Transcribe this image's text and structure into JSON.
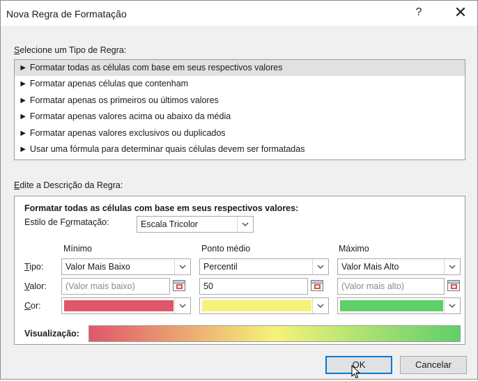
{
  "window": {
    "title": "Nova Regra de Formatação",
    "help_glyph": "?",
    "close_glyph": "✕"
  },
  "rule_type": {
    "heading_access": "S",
    "heading_rest": "elecione um Tipo de Regra:",
    "items": [
      "► Formatar todas as células com base em seus respectivos valores",
      "► Formatar apenas células que contenham",
      "► Formatar apenas os primeiros ou últimos valores",
      "► Formatar apenas valores acima ou abaixo da média",
      "► Formatar apenas valores exclusivos ou duplicados",
      "► Usar uma fórmula para determinar quais células devem ser formatadas"
    ],
    "selected_index": 0
  },
  "description": {
    "heading_access": "E",
    "heading_rest": "dite a Descrição da Regra:",
    "bold_title": "Formatar todas as células com base em seus respectivos valores:",
    "style_label_pre": "Estilo de F",
    "style_label_access": "o",
    "style_label_post": "rmatação:",
    "style_value": "Escala Tricolor",
    "columns": {
      "min": "Mínimo",
      "mid": "Ponto médio",
      "max": "Máximo"
    },
    "row_labels": {
      "type_access": "T",
      "type_rest": "ipo:",
      "value_access": "V",
      "value_rest": "alor:",
      "color_access": "C",
      "color_rest": "or:"
    },
    "type_values": {
      "min": "Valor Mais Baixo",
      "mid": "Percentil",
      "max": "Valor Mais Alto"
    },
    "value_fields": {
      "min_placeholder": "(Valor mais baixo)",
      "mid_value": "50",
      "max_placeholder": "(Valor mais alto)"
    },
    "colors": {
      "min": "#e0566a",
      "mid": "#f5f37a",
      "max": "#5fcf6a"
    },
    "preview_label": "Visualização:"
  },
  "buttons": {
    "ok": "OK",
    "cancel": "Cancelar"
  }
}
